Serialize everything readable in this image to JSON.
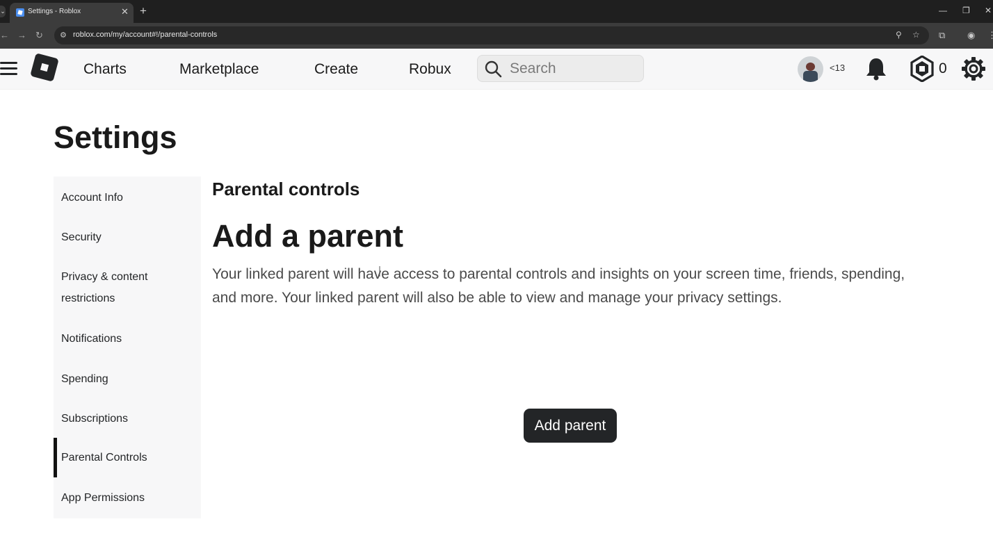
{
  "browser": {
    "tab_title": "Settings - Roblox",
    "url": "roblox.com/my/account#!/parental-controls"
  },
  "header": {
    "nav": [
      "Charts",
      "Marketplace",
      "Create",
      "Robux"
    ],
    "search_placeholder": "Search",
    "age_label": "<13",
    "robux_count": "0"
  },
  "page": {
    "title": "Settings"
  },
  "sidebar": {
    "items": [
      {
        "label": "Account Info"
      },
      {
        "label": "Security"
      },
      {
        "label": "Privacy & content restrictions"
      },
      {
        "label": "Notifications"
      },
      {
        "label": "Spending"
      },
      {
        "label": "Subscriptions"
      },
      {
        "label": "Parental Controls",
        "active": true
      },
      {
        "label": "App Permissions"
      }
    ]
  },
  "main": {
    "section_title": "Parental controls",
    "heading": "Add a parent",
    "description": "Your linked parent will have access to parental controls and insights on your screen time, friends, spending, and more. Your linked parent will also be able to view and manage your privacy settings.",
    "button_label": "Add parent"
  }
}
